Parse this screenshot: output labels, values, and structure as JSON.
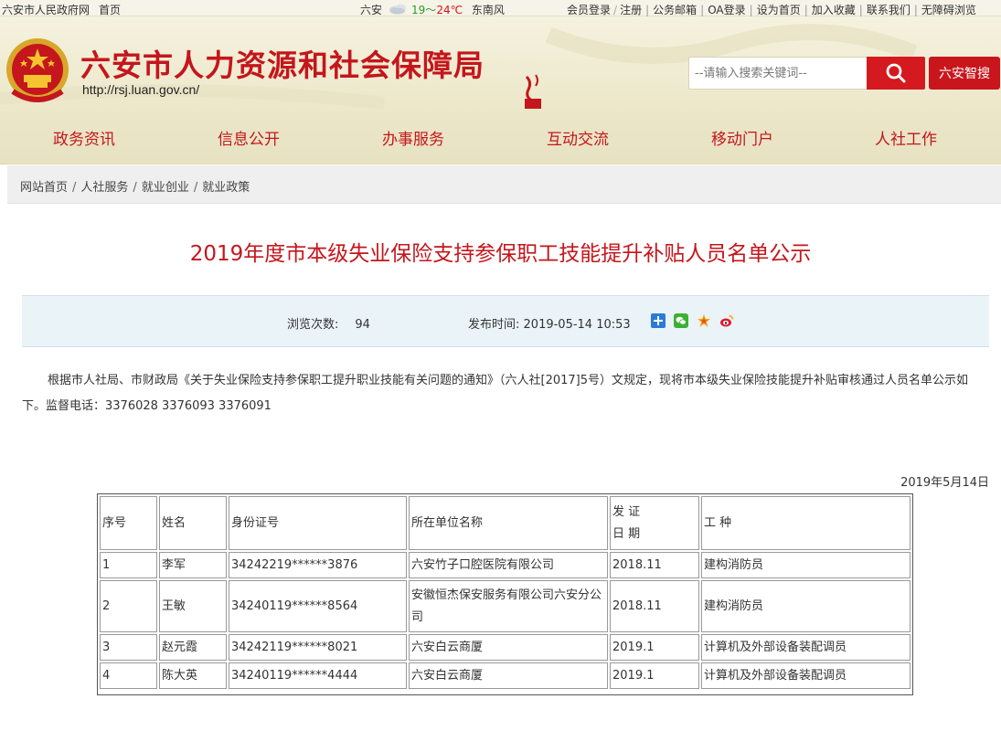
{
  "topbar": {
    "gov_site": "六安市人民政府网",
    "home": "首页",
    "city": "六安",
    "temp_low": "19",
    "temp_sep": "～",
    "temp_high": "24℃",
    "wind": "东南风",
    "links": [
      "会员登录",
      "注册",
      "公务邮箱",
      "OA登录",
      "设为首页",
      "加入收藏",
      "联系我们",
      "无障碍浏览"
    ]
  },
  "header": {
    "site_name": "六安市人力资源和社会保障局",
    "site_url": "http://rsj.luan.gov.cn/",
    "search_placeholder": "--请输入搜索关键词--",
    "smart_search": "六安智搜"
  },
  "nav": [
    "政务资讯",
    "信息公开",
    "办事服务",
    "互动交流",
    "移动门户",
    "人社工作"
  ],
  "breadcrumb": [
    "网站首页",
    "人社服务",
    "就业创业",
    "就业政策"
  ],
  "article": {
    "title": "2019年度市本级失业保险支持参保职工技能提升补贴人员名单公示",
    "views_label": "浏览次数:",
    "views": "94",
    "pub_label": "发布时间:",
    "pub_time": "2019-05-14 10:53",
    "body": "根据市人社局、市财政局《关于失业保险支持参保职工提升职业技能有关问题的通知》（六人社[2017]5号）文规定，现将市本级失业保险技能提升补贴审核通过人员名单公示如下。监督电话：3376028  3376093  3376091",
    "date": "2019年5月14日"
  },
  "table": {
    "headers": [
      "序号",
      "姓名",
      "身份证号",
      "所在单位名称",
      "发 证",
      "日 期",
      "工  种"
    ],
    "rows": [
      {
        "no": "1",
        "name": "李军",
        "id": "34242219******3876",
        "org": "六安竹子口腔医院有限公司",
        "date": "2018.11",
        "job": "建构消防员"
      },
      {
        "no": "2",
        "name": "王敏",
        "id": "34240119******8564",
        "org": "安徽恒杰保安服务有限公司六安分公司",
        "date": "2018.11",
        "job": "建构消防员"
      },
      {
        "no": "3",
        "name": "赵元霞",
        "id": "34242119******8021",
        "org": "六安白云商厦",
        "date": "2019.1",
        "job": "计算机及外部设备装配调员"
      },
      {
        "no": "4",
        "name": "陈大英",
        "id": "34240119******4444",
        "org": "六安白云商厦",
        "date": "2019.1",
        "job": "计算机及外部设备装配调员"
      }
    ]
  },
  "colors": {
    "brand_red": "#c4161c",
    "header_bg": "#f1eed8",
    "meta_bg": "#eaf3f8"
  }
}
